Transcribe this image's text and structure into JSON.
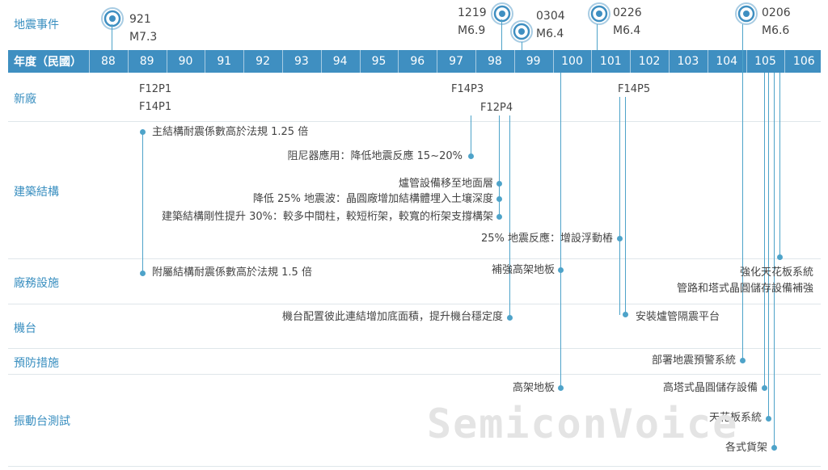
{
  "header_label": "年度（民國）",
  "categories": {
    "earthquake": "地震事件",
    "fab": "新廠",
    "structure": "建築結構",
    "facility": "廠務設施",
    "tool": "機台",
    "prevention": "預防措施",
    "shake_test": "振動台測試"
  },
  "years": [
    "88",
    "89",
    "90",
    "91",
    "92",
    "93",
    "94",
    "95",
    "96",
    "97",
    "98",
    "99",
    "100",
    "101",
    "102",
    "103",
    "104",
    "105",
    "106"
  ],
  "earthquakes": [
    {
      "date": "921",
      "mag": "M7.3"
    },
    {
      "date": "1219",
      "mag": "M6.9"
    },
    {
      "date": "0304",
      "mag": "M6.4"
    },
    {
      "date": "0226",
      "mag": "M6.4"
    },
    {
      "date": "0206",
      "mag": "M6.6"
    }
  ],
  "fabs": {
    "f12p1": "F12P1",
    "f14p1": "F14P1",
    "f14p3": "F14P3",
    "f12p4": "F12P4",
    "f14p5": "F14P5"
  },
  "structure_items": [
    "主結構耐震係數高於法規 1.25 倍",
    "阻尼器應用：降低地震反應 15~20%",
    "爐管設備移至地面層",
    "降低 25% 地震波：晶圓廠增加結構體埋入土壤深度",
    "建築結構剛性提升 30%：較多中間柱，較短桁架，較寬的桁架支撐構架",
    "25% 地震反應：增設浮動樁"
  ],
  "facility_items": [
    "附屬結構耐震係數高於法規 1.5 倍",
    "補強高架地板",
    "強化天花板系統",
    "管路和塔式晶圓儲存設備補強"
  ],
  "tool_items": [
    "機台配置彼此連結增加底面積，提升機台穩定度",
    "安裝爐管隔震平台"
  ],
  "prevention_items": [
    "部署地震預警系統"
  ],
  "shake_test_items": [
    "高架地板",
    "高塔式晶圓儲存設備",
    "天花板系統",
    "各式貨架"
  ],
  "watermark": "SemiconVoice",
  "colors": {
    "accent": "#3f8fc1",
    "line": "#4ea3c9",
    "text": "#444444"
  }
}
